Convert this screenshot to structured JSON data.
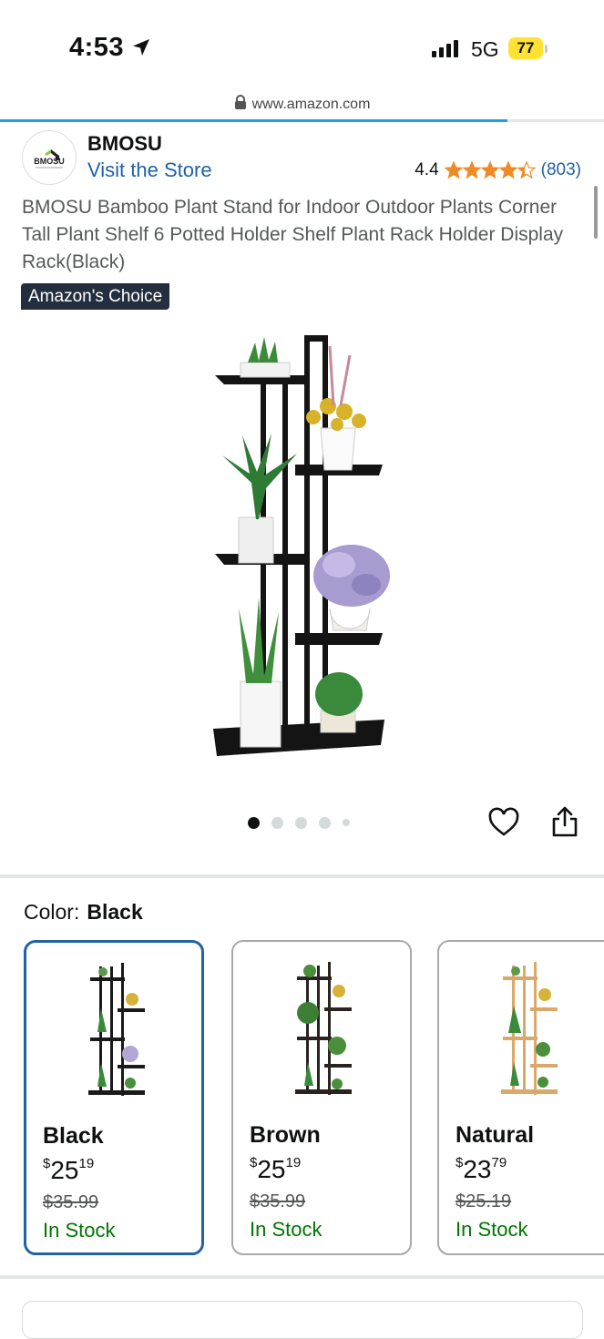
{
  "status_bar": {
    "time": "4:53",
    "network": "5G",
    "battery": "77",
    "icons": [
      "location-arrow-icon",
      "signal-bars-icon",
      "battery-icon"
    ]
  },
  "browser": {
    "url": "www.amazon.com",
    "load_progress": 0.84
  },
  "brand": {
    "name": "BMOSU",
    "visit_store": "Visit the Store",
    "logo_text": "BMOSU"
  },
  "rating": {
    "value": "4.4",
    "stars": 4.4,
    "count": "(803)"
  },
  "product": {
    "title": "BMOSU Bamboo Plant Stand for Indoor Outdoor Plants Corner Tall Plant Shelf 6 Potted Holder Shelf Plant Rack Holder Display Rack(Black)",
    "badge": "Amazon's Choice",
    "image_count": 5,
    "active_image": 0
  },
  "color": {
    "label": "Color:",
    "selected": "Black",
    "options": [
      {
        "name": "Black",
        "currency": "$",
        "price_whole": "25",
        "price_fraction": "19",
        "list_price": "$35.99",
        "stock": "In Stock",
        "frame_color": "#1a1a1a"
      },
      {
        "name": "Brown",
        "currency": "$",
        "price_whole": "25",
        "price_fraction": "19",
        "list_price": "$35.99",
        "stock": "In Stock",
        "frame_color": "#2a2320"
      },
      {
        "name": "Natural",
        "currency": "$",
        "price_whole": "23",
        "price_fraction": "79",
        "list_price": "$25.19",
        "stock": "In Stock",
        "frame_color": "#d9a86a"
      }
    ]
  },
  "colors": {
    "link": "#2162a1",
    "stock": "#007600",
    "badge_bg": "#232f3e",
    "star": "#f08a24",
    "progress": "#1ea0e3"
  }
}
